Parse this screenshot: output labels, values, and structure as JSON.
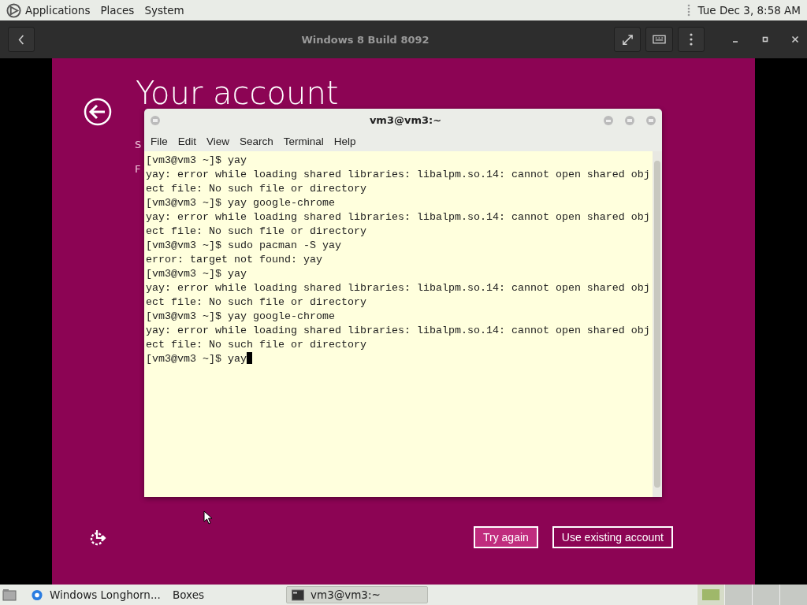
{
  "top_panel": {
    "menus": [
      "Applications",
      "Places",
      "System"
    ],
    "clock": "Tue Dec 3,  8:58 AM"
  },
  "boxes_header": {
    "title": "Windows 8 Build 8092"
  },
  "vm_screen": {
    "heading": "Your account",
    "side_texts": [
      "S",
      "F"
    ],
    "buttons": [
      {
        "label": "Try again",
        "selected": true
      },
      {
        "label": "Use existing account",
        "selected": false
      }
    ]
  },
  "terminal": {
    "title": "vm3@vm3:~",
    "menu": [
      "File",
      "Edit",
      "View",
      "Search",
      "Terminal",
      "Help"
    ],
    "lines": [
      "[vm3@vm3 ~]$ yay",
      "yay: error while loading shared libraries: libalpm.so.14: cannot open shared obj",
      "ect file: No such file or directory",
      "[vm3@vm3 ~]$ yay google-chrome",
      "yay: error while loading shared libraries: libalpm.so.14: cannot open shared obj",
      "ect file: No such file or directory",
      "[vm3@vm3 ~]$ sudo pacman -S yay",
      "error: target not found: yay",
      "[vm3@vm3 ~]$ yay",
      "yay: error while loading shared libraries: libalpm.so.14: cannot open shared obj",
      "ect file: No such file or directory",
      "[vm3@vm3 ~]$ yay google-chrome",
      "yay: error while loading shared libraries: libalpm.so.14: cannot open shared obj",
      "ect file: No such file or directory",
      "[vm3@vm3 ~]$ yay"
    ]
  },
  "taskbar": {
    "items": [
      {
        "label": "Windows Longhorn...",
        "kind": "browser",
        "selected": false
      },
      {
        "label": "Boxes",
        "kind": "plain",
        "selected": false
      },
      {
        "label": "vm3@vm3:~",
        "kind": "terminal",
        "selected": true
      }
    ],
    "workspaces": [
      {
        "selected": true
      },
      {
        "selected": false
      },
      {
        "selected": false
      },
      {
        "selected": false
      }
    ]
  }
}
